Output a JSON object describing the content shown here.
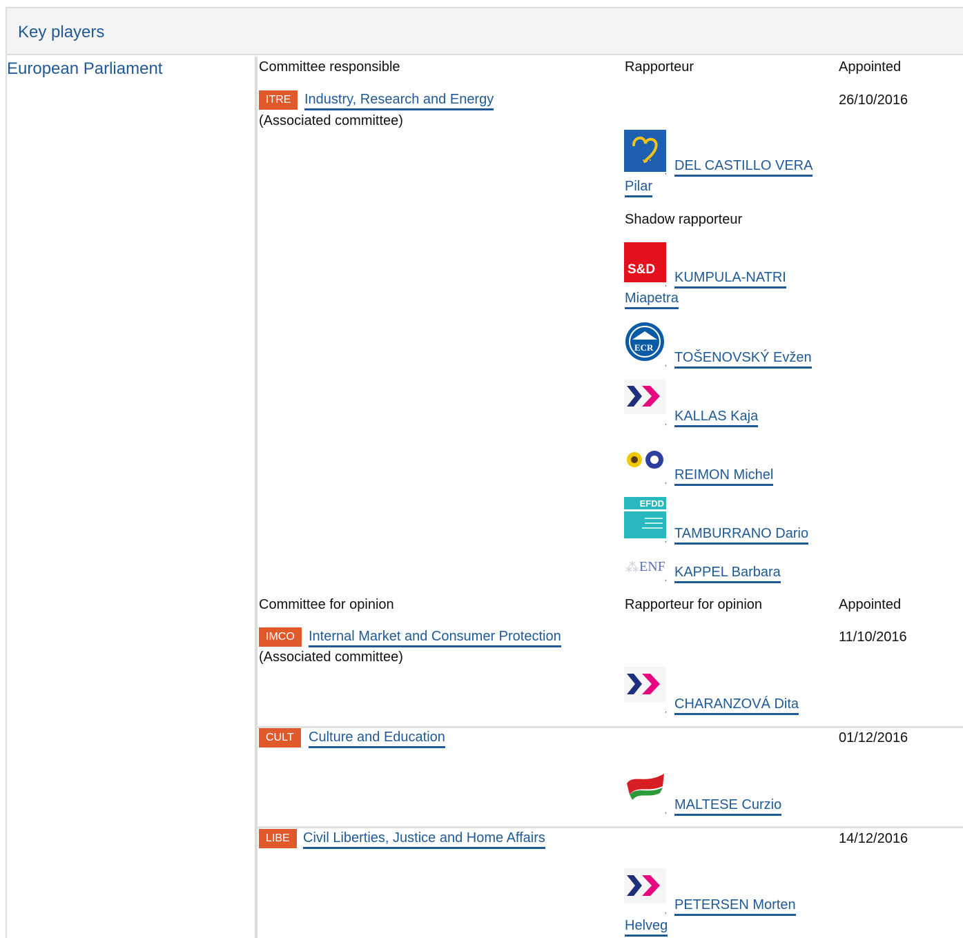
{
  "header": {
    "title": "Key players"
  },
  "institution": {
    "name": "European Parliament"
  },
  "responsible": {
    "col_committee": "Committee responsible",
    "col_rapporteur": "Rapporteur",
    "col_appointed": "Appointed",
    "code": "ITRE",
    "name": "Industry, Research and Energy",
    "note": "(Associated committee)",
    "date": "26/10/2016",
    "rapporteur_line1": "DEL CASTILLO VERA",
    "rapporteur_line2": "Pilar",
    "shadow_label": "Shadow rapporteur",
    "shadows": {
      "s1_line1": "KUMPULA-NATRI",
      "s1_line2": "Miapetra",
      "s2": "TOŠENOVSKÝ Evžen",
      "s3": "KALLAS Kaja",
      "s4": "REIMON Michel",
      "s5": "TAMBURRANO Dario",
      "s6": "KAPPEL Barbara"
    }
  },
  "opinion": {
    "col_committee": "Committee for opinion",
    "col_rapporteur": "Rapporteur for opinion",
    "col_appointed": "Appointed",
    "rows": [
      {
        "code": "IMCO",
        "name": "Internal Market and Consumer Protection",
        "note": "(Associated committee)",
        "date": "11/10/2016",
        "rapporteur": "CHARANZOVÁ Dita"
      },
      {
        "code": "CULT",
        "name": "Culture and Education",
        "date": "01/12/2016",
        "rapporteur": "MALTESE Curzio"
      },
      {
        "code": "LIBE",
        "name": "Civil Liberties, Justice and Home Affairs",
        "date": "14/12/2016",
        "rapporteur_line1": "PETERSEN Morten",
        "rapporteur_line2": "Helveg"
      }
    ]
  },
  "logos": {
    "epp": "EPP group logo",
    "sd": "S&D",
    "ecr": "ECR",
    "alde": "ALDE group logo",
    "greens": "Greens/EFA group logo",
    "efdd": "EFDD",
    "enf": "ENF"
  },
  "colors": {
    "link": "#1f5a96",
    "badge": "#e0592b",
    "header_bg": "#f4f4f4",
    "separator": "#dcdcdc"
  }
}
